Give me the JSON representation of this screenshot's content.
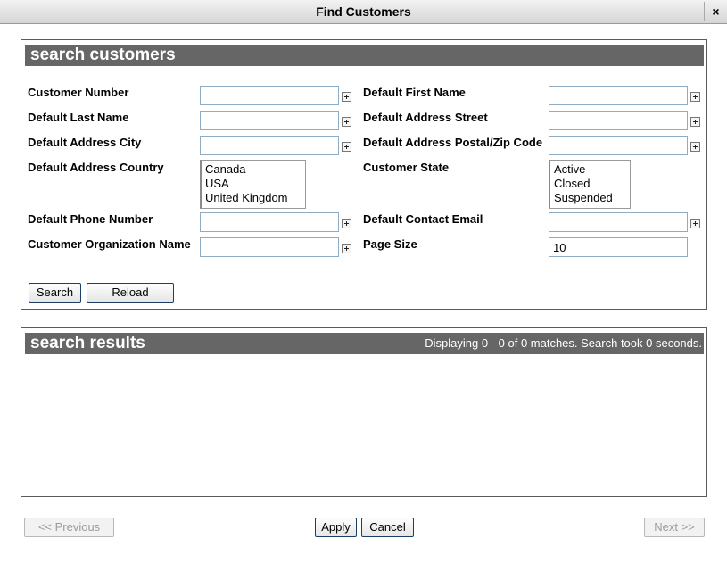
{
  "window": {
    "title": "Find Customers",
    "close_glyph": "×"
  },
  "search_panel": {
    "title": "search customers",
    "labels": {
      "customer_number": "Customer Number",
      "default_first_name": "Default First Name",
      "default_last_name": "Default Last Name",
      "default_address_street": "Default Address Street",
      "default_address_city": "Default Address City",
      "default_address_postal": "Default Address Postal/Zip Code",
      "default_address_country": "Default Address Country",
      "customer_state": "Customer State",
      "default_phone_number": "Default Phone Number",
      "default_contact_email": "Default Contact Email",
      "customer_organization_name": "Customer Organization Name",
      "page_size": "Page Size"
    },
    "values": {
      "customer_number": "",
      "default_first_name": "",
      "default_last_name": "",
      "default_address_street": "",
      "default_address_city": "",
      "default_address_postal": "",
      "default_phone_number": "",
      "default_contact_email": "",
      "customer_organization_name": "",
      "page_size": "10"
    },
    "country_options": [
      "Canada",
      "USA",
      "United Kingdom"
    ],
    "state_options": [
      "Active",
      "Closed",
      "Suspended"
    ],
    "search_button": "Search",
    "reload_button": "Reload"
  },
  "results_panel": {
    "title": "search results",
    "status": "Displaying 0 - 0 of 0 matches. Search took 0 seconds."
  },
  "footer": {
    "previous_button": "<< Previous",
    "apply_button": "Apply",
    "cancel_button": "Cancel",
    "next_button": "Next >>"
  },
  "icons": {
    "add": "plus-box-icon",
    "close": "close-icon"
  },
  "colors": {
    "header_bg": "#666666",
    "button_border": "#1d3f66",
    "input_border": "#8eacc4"
  }
}
